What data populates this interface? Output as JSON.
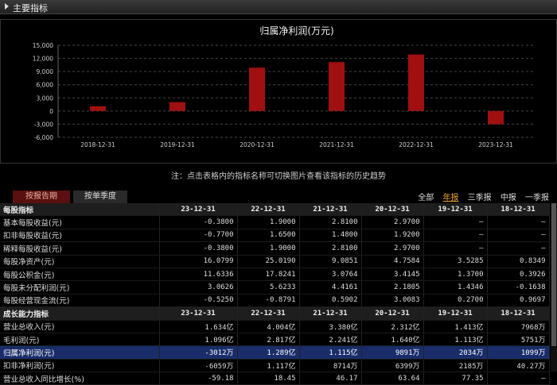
{
  "header": {
    "title": "主要指标"
  },
  "chart_data": {
    "type": "bar",
    "title": "归属净利润(万元)",
    "categories": [
      "2018-12-31",
      "2019-12-31",
      "2020-12-31",
      "2021-12-31",
      "2022-12-31",
      "2023-12-31"
    ],
    "values": [
      1100,
      2034,
      9891,
      11150,
      12890,
      -3012
    ],
    "yticks": [
      15000,
      12000,
      9000,
      6000,
      3000,
      0,
      -3000,
      -6000
    ],
    "ytick_labels": [
      "15,000",
      "12,000",
      "9,000",
      "6,000",
      "3,000",
      "0",
      "-3,000",
      "-6,000"
    ],
    "ylim": [
      -6000,
      15000
    ],
    "grid": true,
    "bar_color": "#a01010"
  },
  "note": "注：点击表格内的指标名称可切换图片查看该指标的历史趋势",
  "tabs": {
    "by_report": "按报告期",
    "by_quarter": "按单季度"
  },
  "periods": [
    "全部",
    "年报",
    "三季报",
    "中报",
    "一季报"
  ],
  "periods_active": "年报",
  "sections": [
    {
      "title": "每股指标",
      "headers": [
        "23-12-31",
        "22-12-31",
        "21-12-31",
        "20-12-31",
        "19-12-31",
        "18-12-31"
      ],
      "rows": [
        {
          "label": "基本每股收益(元)",
          "values": [
            "-0.3800",
            "1.9000",
            "2.8100",
            "2.9700",
            "—",
            "—"
          ]
        },
        {
          "label": "扣非每股收益(元)",
          "values": [
            "-0.7700",
            "1.6500",
            "1.4800",
            "1.9200",
            "—",
            "—"
          ]
        },
        {
          "label": "稀释每股收益(元)",
          "values": [
            "-0.3800",
            "1.9000",
            "2.8100",
            "2.9700",
            "—",
            "—"
          ]
        },
        {
          "label": "每股净资产(元)",
          "values": [
            "16.0799",
            "25.0190",
            "9.0851",
            "4.7584",
            "3.5285",
            "0.8349"
          ]
        },
        {
          "label": "每股公积金(元)",
          "values": [
            "11.6336",
            "17.8241",
            "3.0764",
            "3.4145",
            "1.3700",
            "0.3926"
          ]
        },
        {
          "label": "每股未分配利润(元)",
          "values": [
            "3.0626",
            "5.6233",
            "4.4161",
            "2.1805",
            "1.4346",
            "-0.1638"
          ]
        },
        {
          "label": "每股经营现金流(元)",
          "values": [
            "-0.5250",
            "-0.8791",
            "0.5902",
            "3.0083",
            "0.2700",
            "0.9697"
          ]
        }
      ]
    },
    {
      "title": "成长能力指标",
      "headers": [
        "23-12-31",
        "22-12-31",
        "21-12-31",
        "20-12-31",
        "19-12-31",
        "18-12-31"
      ],
      "rows": [
        {
          "label": "营业总收入(元)",
          "values": [
            "1.634亿",
            "4.004亿",
            "3.380亿",
            "2.312亿",
            "1.413亿",
            "7968万"
          ]
        },
        {
          "label": "毛利润(元)",
          "values": [
            "1.096亿",
            "2.817亿",
            "2.241亿",
            "1.640亿",
            "1.113亿",
            "5751万"
          ]
        },
        {
          "label": "归属净利润(元)",
          "values": [
            "-3012万",
            "1.289亿",
            "1.115亿",
            "9891万",
            "2034万",
            "1099万"
          ],
          "highlight": true
        },
        {
          "label": "扣非净利润(元)",
          "values": [
            "-6059万",
            "1.117亿",
            "8714万",
            "6399万",
            "2185万",
            "40.27万"
          ]
        },
        {
          "label": "营业总收入同比增长(%)",
          "values": [
            "-59.18",
            "18.45",
            "46.17",
            "63.64",
            "77.35",
            "—"
          ]
        }
      ]
    }
  ]
}
